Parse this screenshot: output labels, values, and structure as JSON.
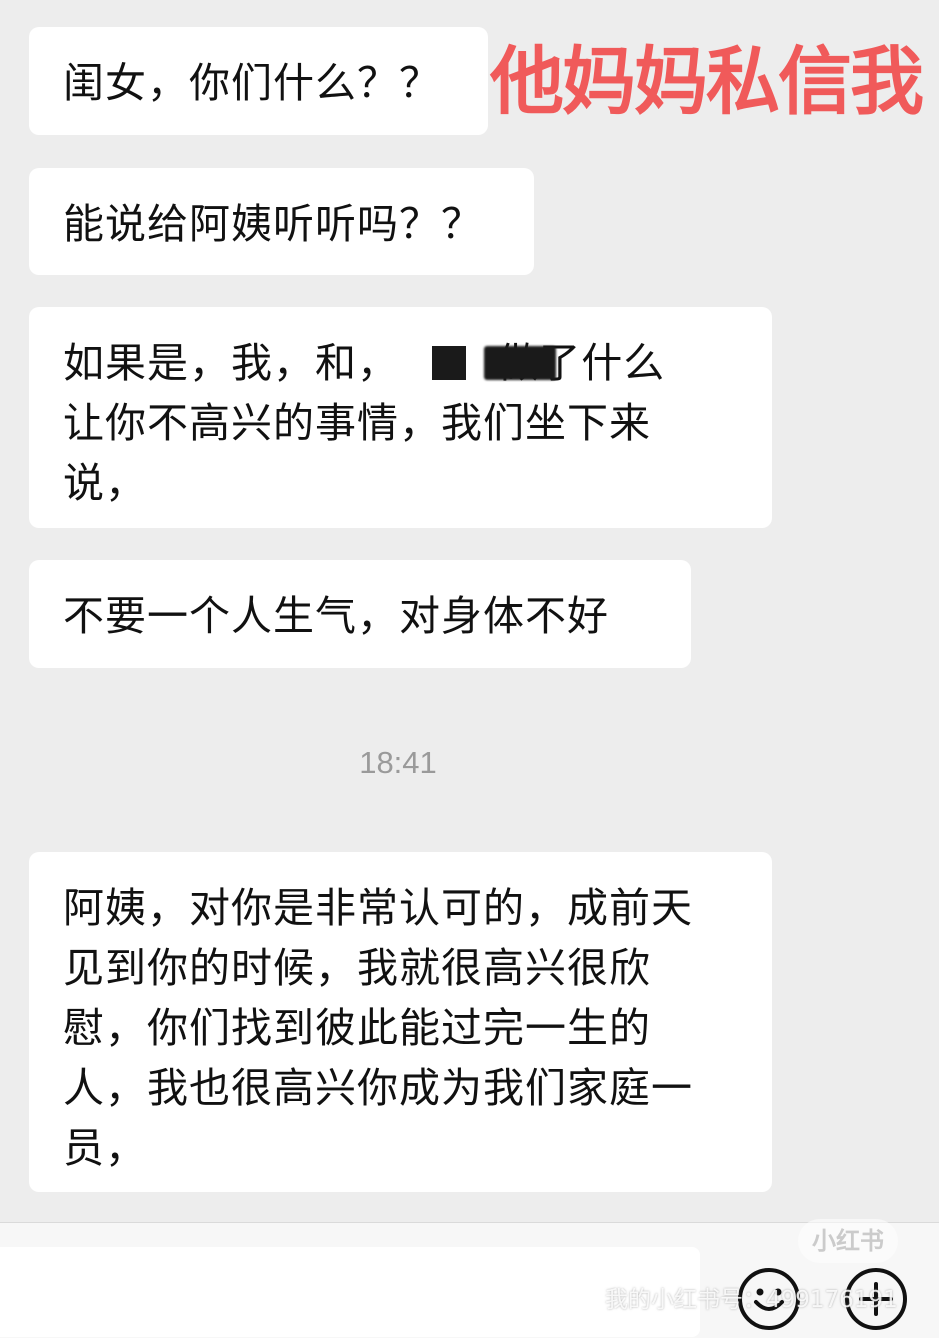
{
  "chat": {
    "messages": [
      {
        "text": "闺女，你们什么？？"
      },
      {
        "text": "能说给阿姨听听吗？？"
      },
      {
        "text": "如果是，我，和，       做了什么\n让你不高兴的事情，我们坐下来\n说，"
      },
      {
        "text": "不要一个人生气，对身体不好"
      },
      {
        "text": "阿姨，对你是非常认可的，成前天\n见到你的时候，我就很高兴很欣\n慰，你们找到彼此能过完一生的\n人，我也很高兴你成为我们家庭一\n员，"
      }
    ],
    "timestamp": "18:41"
  },
  "overlay": {
    "caption": "他妈妈私信我",
    "caption_color": "#f05a5a"
  },
  "input_bar": {
    "emoji_button_icon": "smiley-face-icon",
    "more_button_icon": "plus-icon"
  },
  "watermark": {
    "logo_text": "小红书",
    "account_text": "我的小红书号：499176191"
  }
}
